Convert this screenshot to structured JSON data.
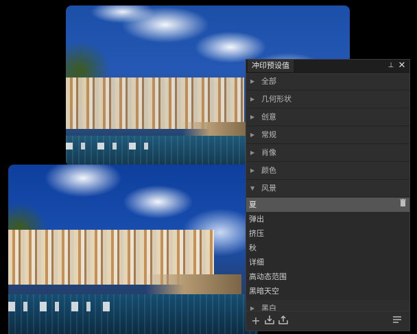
{
  "panel": {
    "title": "冲印预设值",
    "pin_glyph": "⊥",
    "close_glyph": "✕",
    "categories": [
      {
        "label": "全部",
        "expanded": false
      },
      {
        "label": "几何形状",
        "expanded": false
      },
      {
        "label": "创意",
        "expanded": false
      },
      {
        "label": "常规",
        "expanded": false
      },
      {
        "label": "肖像",
        "expanded": false
      },
      {
        "label": "颜色",
        "expanded": false
      },
      {
        "label": "风景",
        "expanded": true
      }
    ],
    "landscape_presets": [
      {
        "label": "夏",
        "selected": true
      },
      {
        "label": "弹出",
        "selected": false
      },
      {
        "label": "挤压",
        "selected": false
      },
      {
        "label": "秋",
        "selected": false
      },
      {
        "label": "详细",
        "selected": false
      },
      {
        "label": "高动态范围",
        "selected": false
      },
      {
        "label": "黑暗天空",
        "selected": false
      }
    ],
    "last_category": {
      "label": "黑白",
      "expanded": false
    },
    "footer_icons": [
      "add-icon",
      "import-icon",
      "share-icon",
      "menu-icon"
    ]
  },
  "colors": {
    "panel_bg": "#2a2a2a",
    "selected_row": "#555555",
    "sky": "#2458b4"
  }
}
